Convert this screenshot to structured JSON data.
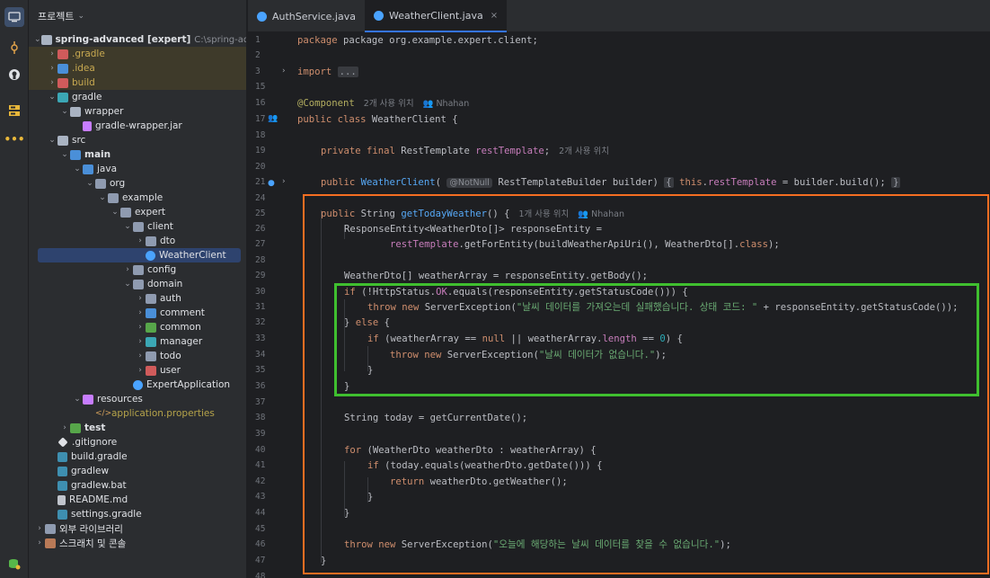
{
  "project_header": {
    "title": "프로젝트",
    "chevron": "⌄"
  },
  "tree": [
    {
      "depth": 0,
      "arrow": "⌄",
      "icon": "folder",
      "label": "spring-advanced [expert]",
      "hint": "C:\\spring-advanced",
      "bold": true
    },
    {
      "depth": 1,
      "arrow": "›",
      "icon": "folder-orange",
      "label": ".gradle",
      "style": "excluded"
    },
    {
      "depth": 1,
      "arrow": "›",
      "icon": "folder-blue",
      "label": ".idea",
      "style": "excluded"
    },
    {
      "depth": 1,
      "arrow": "›",
      "icon": "folder-orange",
      "label": "build",
      "style": "excluded"
    },
    {
      "depth": 1,
      "arrow": "⌄",
      "icon": "folder-teal",
      "label": "gradle"
    },
    {
      "depth": 2,
      "arrow": "⌄",
      "icon": "folder",
      "label": "wrapper"
    },
    {
      "depth": 3,
      "arrow": "",
      "icon": "jar",
      "label": "gradle-wrapper.jar"
    },
    {
      "depth": 1,
      "arrow": "⌄",
      "icon": "folder",
      "label": "src"
    },
    {
      "depth": 2,
      "arrow": "⌄",
      "icon": "folder-blue",
      "label": "main",
      "bold": true
    },
    {
      "depth": 3,
      "arrow": "⌄",
      "icon": "folder-src",
      "label": "java"
    },
    {
      "depth": 4,
      "arrow": "⌄",
      "icon": "folder-pkg",
      "label": "org"
    },
    {
      "depth": 5,
      "arrow": "⌄",
      "icon": "folder-pkg",
      "label": "example"
    },
    {
      "depth": 6,
      "arrow": "⌄",
      "icon": "folder-pkg",
      "label": "expert"
    },
    {
      "depth": 7,
      "arrow": "⌄",
      "icon": "folder-pkg",
      "label": "client"
    },
    {
      "depth": 8,
      "arrow": "›",
      "icon": "folder-pkg",
      "label": "dto"
    },
    {
      "depth": 8,
      "arrow": "",
      "icon": "file-class",
      "label": "WeatherClient",
      "selected": true
    },
    {
      "depth": 7,
      "arrow": "›",
      "icon": "folder-pkg",
      "label": "config"
    },
    {
      "depth": 7,
      "arrow": "⌄",
      "icon": "folder-pkg",
      "label": "domain"
    },
    {
      "depth": 8,
      "arrow": "›",
      "icon": "folder-pkg",
      "label": "auth"
    },
    {
      "depth": 8,
      "arrow": "›",
      "icon": "folder-blue",
      "label": "comment"
    },
    {
      "depth": 8,
      "arrow": "›",
      "icon": "folder-test",
      "label": "common"
    },
    {
      "depth": 8,
      "arrow": "›",
      "icon": "folder-teal",
      "label": "manager"
    },
    {
      "depth": 8,
      "arrow": "›",
      "icon": "folder-pkg",
      "label": "todo"
    },
    {
      "depth": 8,
      "arrow": "›",
      "icon": "folder-orange",
      "label": "user"
    },
    {
      "depth": 7,
      "arrow": "",
      "icon": "file-app",
      "label": "ExpertApplication"
    },
    {
      "depth": 3,
      "arrow": "⌄",
      "icon": "folder-res",
      "label": "resources"
    },
    {
      "depth": 4,
      "arrow": "",
      "icon": "file-props",
      "label": "application.properties",
      "style": "res"
    },
    {
      "depth": 2,
      "arrow": "›",
      "icon": "folder-test",
      "label": "test",
      "bold": true
    },
    {
      "depth": 1,
      "arrow": "",
      "icon": "file-git",
      "label": ".gitignore"
    },
    {
      "depth": 1,
      "arrow": "",
      "icon": "file-gradle",
      "label": "build.gradle"
    },
    {
      "depth": 1,
      "arrow": "",
      "icon": "file-gradle",
      "label": "gradlew"
    },
    {
      "depth": 1,
      "arrow": "",
      "icon": "file-gradle",
      "label": "gradlew.bat"
    },
    {
      "depth": 1,
      "arrow": "",
      "icon": "file-md",
      "label": "README.md"
    },
    {
      "depth": 1,
      "arrow": "",
      "icon": "file-gradle",
      "label": "settings.gradle"
    },
    {
      "depth": 0,
      "arrow": "›",
      "icon": "libs",
      "label": "외부 라이브러리"
    },
    {
      "depth": 0,
      "arrow": "›",
      "icon": "scratch",
      "label": "스크래치 및 콘솔"
    }
  ],
  "tabs": [
    {
      "label": "AuthService.java",
      "active": false
    },
    {
      "label": "WeatherClient.java",
      "active": true,
      "close": "×"
    }
  ],
  "line_numbers": [
    "1",
    "2",
    "3",
    "15",
    "16",
    "17",
    "18",
    "19",
    "20",
    "21",
    "24",
    "25",
    "26",
    "27",
    "28",
    "29",
    "30",
    "31",
    "32",
    "33",
    "34",
    "35",
    "36",
    "37",
    "38",
    "39",
    "40",
    "41",
    "42",
    "43",
    "44",
    "45",
    "46",
    "47",
    "48"
  ],
  "code": {
    "l1": [
      "package org.example.expert.client;"
    ],
    "l3_import": "import",
    "l3_fold": "...",
    "l16_ann": "@Component",
    "l16_hint": "2개 사용 위치",
    "l16_author": "Nhahan",
    "l17": "public class WeatherClient {",
    "l19": "private final RestTemplate restTemplate;",
    "l19_hint": "2개 사용 위치",
    "l21_a": "public WeatherClient(",
    "l21_notnull": "@NotNull",
    "l21_b": "RestTemplateBuilder builder)",
    "l21_c": "{ this.restTemplate = builder.build(); }",
    "l25": "public String getTodayWeather() {",
    "l25_hint": "1개 사용 위치",
    "l25_author": "Nhahan",
    "l26": "ResponseEntity<WeatherDto[]> responseEntity =",
    "l27": "restTemplate.getForEntity(buildWeatherApiUri(), WeatherDto[].class);",
    "l29": "WeatherDto[] weatherArray = responseEntity.getBody();",
    "l30": "if (!HttpStatus.OK.equals(responseEntity.getStatusCode())) {",
    "l31_a": "throw new ServerException(",
    "l31_str": "\"날씨 데이터를 가져오는데 실패했습니다. 상태 코드: \"",
    "l31_b": " + responseEntity.getStatusCode());",
    "l32": "} else {",
    "l33": "if (weatherArray == null || weatherArray.length == 0) {",
    "l34_a": "throw new ServerException(",
    "l34_str": "\"날씨 데이터가 없습니다.\"",
    "l34_b": ");",
    "l35": "}",
    "l36": "}",
    "l38": "String today = getCurrentDate();",
    "l40": "for (WeatherDto weatherDto : weatherArray) {",
    "l41": "if (today.equals(weatherDto.getDate())) {",
    "l42": "return weatherDto.getWeather();",
    "l43": "}",
    "l44": "}",
    "l46_a": "throw new ServerException(",
    "l46_str": "\"오늘에 해당하는 날씨 데이터를 찾을 수 없습니다.\"",
    "l46_b": ");",
    "l47": "}"
  },
  "colors": {
    "highlight_box_outer": "#f56e22",
    "highlight_box_inner": "#3fbf2f",
    "accent": "#3574f0"
  },
  "activity_icons": [
    "project-icon",
    "commit-icon",
    "github-icon",
    "structure-icon",
    "more-icon",
    "services-icon"
  ]
}
